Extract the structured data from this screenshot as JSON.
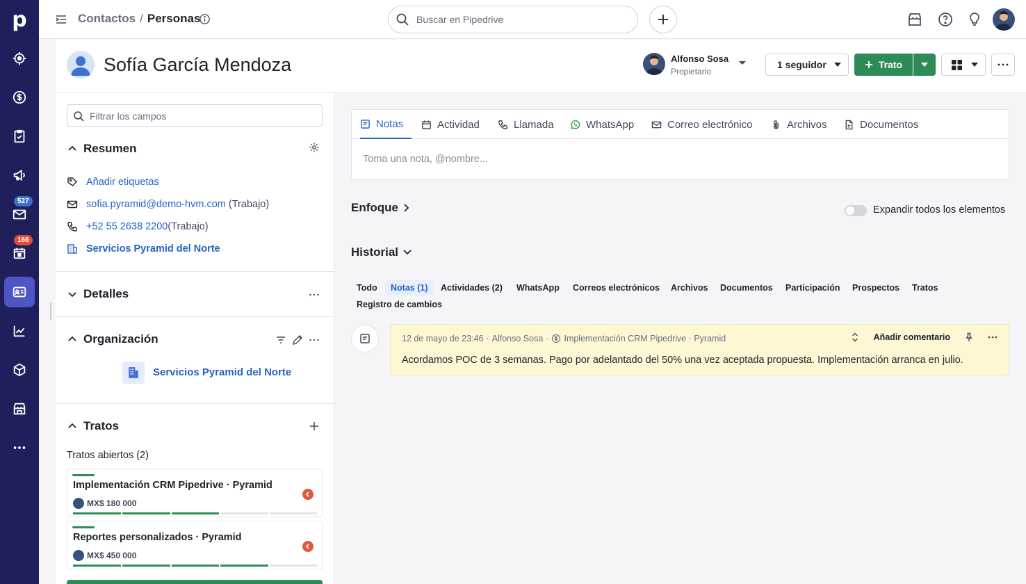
{
  "nav": {
    "logo": "p",
    "items": [
      {
        "name": "nav-leads-icon"
      },
      {
        "name": "nav-deals-icon"
      },
      {
        "name": "nav-activities-icon"
      },
      {
        "name": "nav-campaigns-icon"
      },
      {
        "name": "nav-mail-icon",
        "badge": "527"
      },
      {
        "name": "nav-calendar-icon",
        "badge": "166"
      },
      {
        "name": "nav-contacts-icon"
      },
      {
        "name": "nav-insights-icon"
      },
      {
        "name": "nav-products-icon"
      },
      {
        "name": "nav-marketplace-icon"
      },
      {
        "name": "nav-more-icon"
      }
    ]
  },
  "topbar": {
    "breadcrumb_parent": "Contactos",
    "breadcrumb_separator": "/",
    "breadcrumb_current": "Personas",
    "search_placeholder": "Buscar en Pipedrive"
  },
  "header": {
    "person_name": "Sofía García Mendoza",
    "owner_name": "Alfonso Sosa",
    "owner_role": "Propietario",
    "follow_label": "1 seguidor",
    "deal_button_label": "Trato"
  },
  "left": {
    "filter_placeholder": "Filtrar los campos",
    "summary": {
      "title": "Resumen",
      "add_tags": "Añadir etiquetas",
      "email": "sofia.pyramid@demo-hvm.com",
      "email_type": "(Trabajo)",
      "phone": "+52 55 2638 2200",
      "phone_type": "(Trabajo)",
      "organization": "Servicios Pyramid del Norte"
    },
    "details": {
      "title": "Detalles"
    },
    "organization_section": {
      "title": "Organización",
      "name": "Servicios Pyramid del Norte"
    },
    "deals": {
      "title": "Tratos",
      "open_label": "Tratos abiertos (2)",
      "items": [
        {
          "title": "Implementación CRM Pipedrive · Pyramid",
          "value": "MX$ 180 000",
          "stages_done": 3
        },
        {
          "title": "Reportes personalizados · Pyramid",
          "value": "MX$ 450 000",
          "stages_done": 4
        }
      ]
    }
  },
  "composer": {
    "tabs": [
      {
        "label": "Notas",
        "icon": "note-icon"
      },
      {
        "label": "Actividad",
        "icon": "calendar-icon"
      },
      {
        "label": "Llamada",
        "icon": "phone-icon"
      },
      {
        "label": "WhatsApp",
        "icon": "whatsapp-icon"
      },
      {
        "label": "Correo electrónico",
        "icon": "mail-icon"
      },
      {
        "label": "Archivos",
        "icon": "paperclip-icon"
      },
      {
        "label": "Documentos",
        "icon": "document-icon"
      }
    ],
    "placeholder": "Toma una nota, @nombre..."
  },
  "focus": {
    "title": "Enfoque",
    "toggle_label": "Expandir todos los elementos",
    "toggle_on": false
  },
  "history": {
    "title": "Historial",
    "filters": [
      "Todo",
      "Notas (1)",
      "Actividades (2)",
      "WhatsApp",
      "Correos electrónicos",
      "Archivos",
      "Documentos",
      "Participación",
      "Prospectos",
      "Tratos",
      "Registro de cambios"
    ],
    "active_filter": "Notas (1)",
    "note": {
      "date": "12 de mayo de 23:46",
      "author": "Alfonso Sosa",
      "deal": "Implementación CRM Pipedrive · Pyramid",
      "add_comment": "Añadir comentario",
      "text": "Acordamos POC de 3 semanas. Pago por adelantado del 50% una vez aceptada propuesta. Implementación arranca en julio."
    }
  }
}
